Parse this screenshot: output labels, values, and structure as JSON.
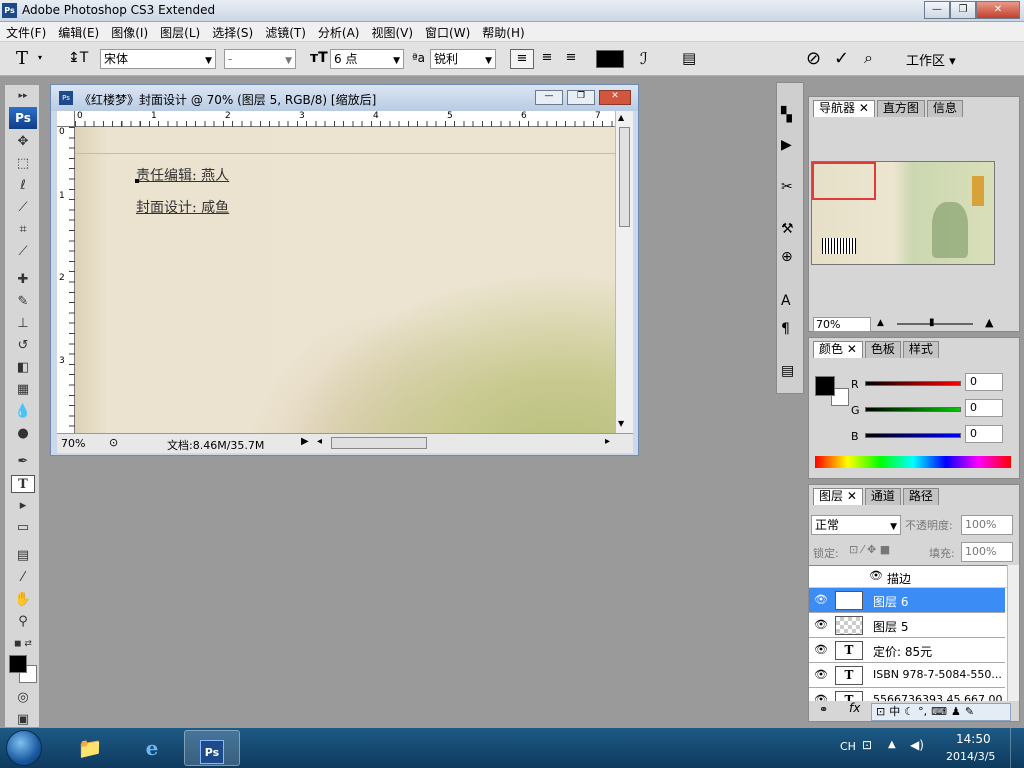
{
  "app": {
    "title": "Adobe Photoshop CS3 Extended",
    "icon_label": "Ps"
  },
  "window_controls": {
    "minimize": "—",
    "maximize": "❐",
    "close": "✕"
  },
  "menu": [
    "文件(F)",
    "编辑(E)",
    "图像(I)",
    "图层(L)",
    "选择(S)",
    "滤镜(T)",
    "分析(A)",
    "视图(V)",
    "窗口(W)",
    "帮助(H)"
  ],
  "options_bar": {
    "font_family": "宋体",
    "font_style": "-",
    "font_size": "6 点",
    "antialias": "锐利",
    "workspace": "工作区",
    "text_color": "#000000"
  },
  "document": {
    "title": "《红楼梦》封面设计 @ 70% (图层 5, RGB/8) [缩放后]",
    "zoom": "70%",
    "doc_info": "文档:8.46M/35.7M",
    "ruler_h": [
      "0",
      "1",
      "2",
      "3",
      "4",
      "5",
      "6",
      "7"
    ],
    "ruler_v": [
      "0",
      "1",
      "2",
      "3"
    ],
    "line1": "责任编辑: 燕人",
    "line2": "封面设计: 咸鱼"
  },
  "navigator": {
    "tabs": [
      "导航器",
      "直方图",
      "信息"
    ],
    "zoom": "70%"
  },
  "color_panel": {
    "tabs": [
      "颜色",
      "色板",
      "样式"
    ],
    "r_label": "R",
    "g_label": "G",
    "b_label": "B",
    "r": "0",
    "g": "0",
    "b": "0"
  },
  "layers_panel": {
    "tabs": [
      "图层",
      "通道",
      "路径"
    ],
    "blend_mode": "正常",
    "opacity_label": "不透明度:",
    "opacity": "100%",
    "lock_label": "锁定:",
    "fill_label": "填充:",
    "fill": "100%",
    "effect_stroke": "描边",
    "layers": [
      {
        "name": "图层 6",
        "type": "T",
        "selected": true
      },
      {
        "name": "图层 5",
        "type": "pixel",
        "selected": false
      },
      {
        "name": "定价: 85元",
        "type": "T",
        "selected": false
      },
      {
        "name": "ISBN 978-7-5084-550...",
        "type": "T",
        "selected": false
      },
      {
        "name": "5566736393 45 667 00",
        "type": "T",
        "selected": false
      }
    ]
  },
  "ime_bar": [
    "中",
    "☾",
    "°,",
    "⌨",
    "♟",
    "✎"
  ],
  "taskbar": {
    "lang": "CH",
    "time": "14:50",
    "date": "2014/3/5",
    "ps_label": "Ps"
  }
}
